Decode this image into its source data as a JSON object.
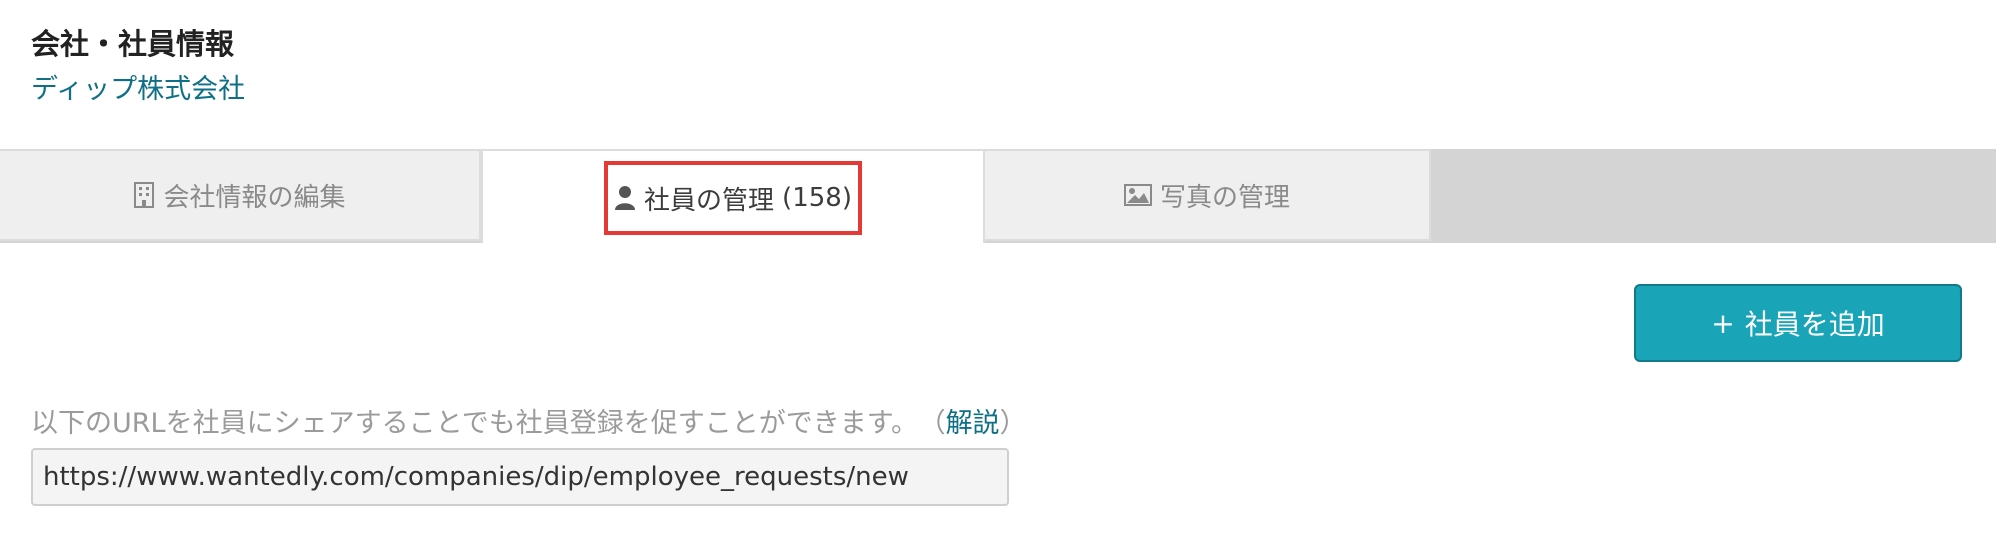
{
  "header": {
    "title": "会社・社員情報",
    "company_name": "ディップ株式会社"
  },
  "tabs": {
    "company": {
      "label": "会社情報の編集",
      "icon": "building-icon"
    },
    "employees": {
      "label": "社員の管理",
      "count": "(158)",
      "icon": "user-icon",
      "active": true,
      "highlight_color": "#e53935"
    },
    "photos": {
      "label": "写真の管理",
      "icon": "image-icon"
    }
  },
  "actions": {
    "add_employee_plus": "+",
    "add_employee_label": "社員を追加",
    "button_color": "#1aa4b8"
  },
  "share": {
    "text": "以下のURLを社員にシェアすることでも社員登録を促すことができます。",
    "explain_open": "（",
    "explain_label": "解説",
    "explain_close": "）",
    "url_value": "https://www.wantedly.com/companies/dip/employee_requests/new"
  }
}
